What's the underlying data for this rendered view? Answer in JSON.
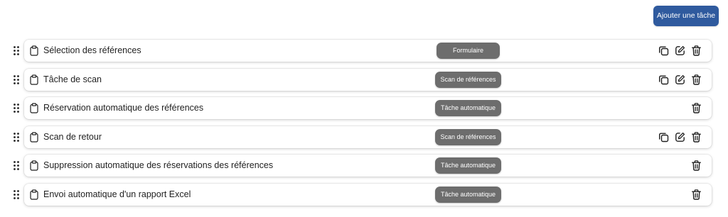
{
  "toolbar": {
    "add_task_label": "Ajouter une tâche"
  },
  "tasks": [
    {
      "label": "Sélection des références",
      "badge": "Formulaire",
      "actions": [
        "copy-icon",
        "edit-icon",
        "trash-icon"
      ]
    },
    {
      "label": "Tâche de scan",
      "badge": "Scan de références",
      "actions": [
        "copy-icon",
        "edit-icon",
        "trash-icon"
      ]
    },
    {
      "label": "Réservation automatique des références",
      "badge": "Tâche automatique",
      "actions": [
        "trash-icon"
      ]
    },
    {
      "label": "Scan de retour",
      "badge": "Scan de références",
      "actions": [
        "copy-icon",
        "edit-icon",
        "trash-icon"
      ]
    },
    {
      "label": "Suppression automatique des réservations des références",
      "badge": "Tâche automatique",
      "actions": [
        "trash-icon"
      ]
    },
    {
      "label": "Envoi automatique d'un rapport Excel",
      "badge": "Tâche automatique",
      "actions": [
        "trash-icon"
      ]
    }
  ],
  "colors": {
    "primary_button": "#2f5a9e",
    "badge_background": "#6d6d6d",
    "text": "#1f1f1f"
  }
}
